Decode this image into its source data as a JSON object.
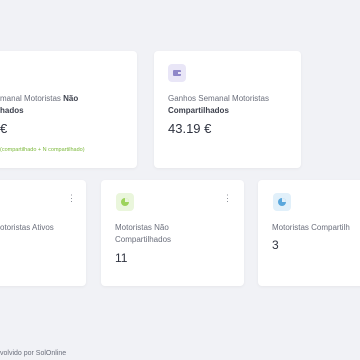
{
  "card_not_shared": {
    "label_line1": "manal Motoristas ",
    "label_bold1": "Não",
    "label_line2_bold": "hados",
    "value": "€",
    "note": "(compartilhado + N compartilhado)"
  },
  "card_shared": {
    "icon": "wallet-icon",
    "label_line1": "Ganhos Semanal Motoristas",
    "label_line2_bold": "Compartilhados",
    "value": "43.19 €"
  },
  "card_active": {
    "label": "otoristas Ativos",
    "menu": "⋮"
  },
  "card_drivers_not_shared": {
    "icon": "pie-chart-icon",
    "label_line1": "Motoristas Não",
    "label_line2": "Compartilhados",
    "value": "11",
    "menu": "⋮"
  },
  "card_drivers_shared": {
    "icon": "pie-chart-icon",
    "label": "Motoristas Compartilh",
    "value": "3"
  },
  "footer": {
    "text": "volvido por SolOnline"
  },
  "colors": {
    "green": "#9dd35b",
    "purple": "#8f87c9",
    "blue": "#5aa7dc",
    "note_green": "#7bb83a"
  }
}
